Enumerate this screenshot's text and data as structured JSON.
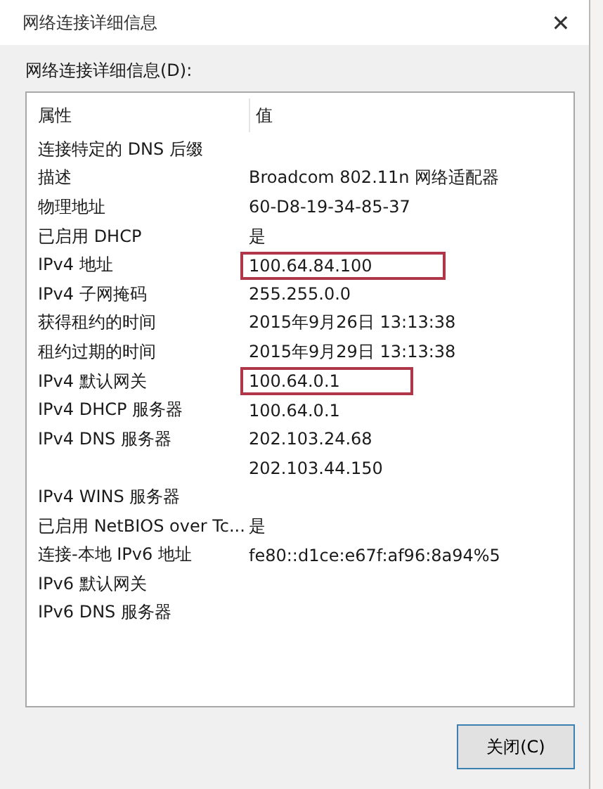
{
  "window": {
    "title": "网络连接详细信息",
    "close": "✕"
  },
  "list_label": "网络连接详细信息(D):",
  "table": {
    "columns": [
      "属性",
      "值"
    ],
    "rows": [
      {
        "property": "连接特定的 DNS 后缀",
        "value": "",
        "highlighted": false
      },
      {
        "property": "描述",
        "value": "Broadcom 802.11n 网络适配器",
        "highlighted": false
      },
      {
        "property": "物理地址",
        "value": "60-D8-19-34-85-37",
        "highlighted": false
      },
      {
        "property": "已启用 DHCP",
        "value": "是",
        "highlighted": false
      },
      {
        "property": "IPv4 地址",
        "value": "100.64.84.100",
        "highlighted": true
      },
      {
        "property": "IPv4 子网掩码",
        "value": "255.255.0.0",
        "highlighted": false
      },
      {
        "property": "获得租约的时间",
        "value": "2015年9月26日 13:13:38",
        "highlighted": false
      },
      {
        "property": "租约过期的时间",
        "value": "2015年9月29日 13:13:38",
        "highlighted": false
      },
      {
        "property": "IPv4 默认网关",
        "value": "100.64.0.1",
        "highlighted": true
      },
      {
        "property": "IPv4 DHCP 服务器",
        "value": "100.64.0.1",
        "highlighted": false
      },
      {
        "property": "IPv4 DNS 服务器",
        "value": "202.103.24.68",
        "highlighted": false
      },
      {
        "property": "",
        "value": "202.103.44.150",
        "highlighted": false
      },
      {
        "property": "IPv4 WINS 服务器",
        "value": "",
        "highlighted": false
      },
      {
        "property": "已启用 NetBIOS over Tc...",
        "value": "是",
        "highlighted": false
      },
      {
        "property": "连接-本地 IPv6 地址",
        "value": "fe80::d1ce:e67f:af96:8a94%5",
        "highlighted": false
      },
      {
        "property": "IPv6 默认网关",
        "value": "",
        "highlighted": false
      },
      {
        "property": "IPv6 DNS 服务器",
        "value": "",
        "highlighted": false
      }
    ]
  },
  "buttons": [
    "关闭(C)"
  ]
}
